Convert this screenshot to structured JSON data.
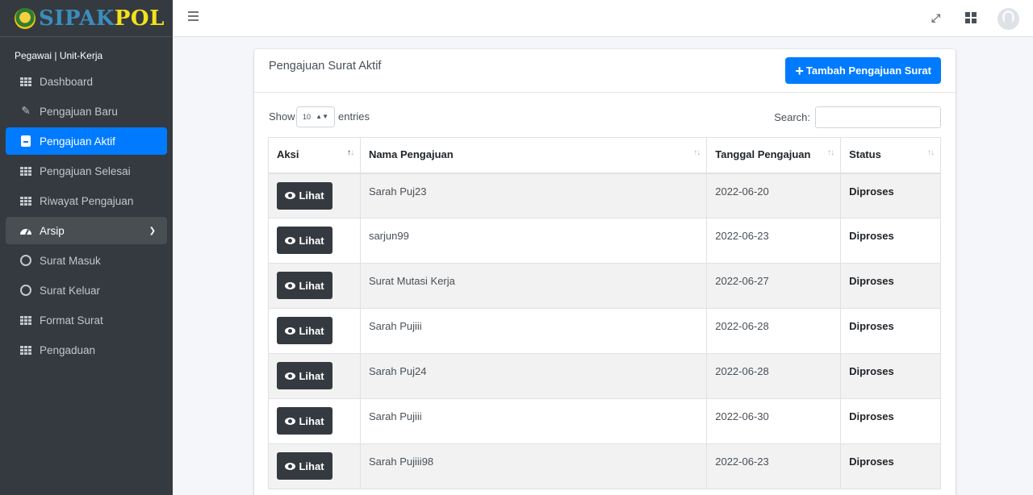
{
  "brand": {
    "part1": "SIPAK",
    "part2": "POL"
  },
  "user_label": "Pegawai | Unit-Kerja",
  "sidebar": {
    "items": [
      {
        "label": "Dashboard",
        "icon": "grid-icon"
      },
      {
        "label": "Pengajuan Baru",
        "icon": "edit-icon"
      },
      {
        "label": "Pengajuan Aktif",
        "icon": "document-icon",
        "active": true
      },
      {
        "label": "Pengajuan Selesai",
        "icon": "grid-icon"
      },
      {
        "label": "Riwayat Pengajuan",
        "icon": "grid-icon"
      },
      {
        "label": "Arsip",
        "icon": "dashboard-gauge-icon",
        "expanded": true
      },
      {
        "label": "Surat Masuk",
        "icon": "circle-icon"
      },
      {
        "label": "Surat Keluar",
        "icon": "circle-icon"
      },
      {
        "label": "Format Surat",
        "icon": "grid-icon"
      },
      {
        "label": "Pengaduan",
        "icon": "grid-icon"
      }
    ]
  },
  "card": {
    "title": "Pengajuan Surat Aktif",
    "add_button": "Tambah Pengajuan Surat"
  },
  "controls": {
    "show_label": "Show",
    "entries_value": "10",
    "entries_label": "entries",
    "search_label": "Search:"
  },
  "table": {
    "headers": [
      "Aksi",
      "Nama Pengajuan",
      "Tanggal Pengajuan",
      "Status"
    ],
    "action_label": "Lihat",
    "rows": [
      {
        "nama": "Sarah Puj23",
        "tanggal": "2022-06-20",
        "status": "Diproses"
      },
      {
        "nama": "sarjun99",
        "tanggal": "2022-06-23",
        "status": "Diproses"
      },
      {
        "nama": "Surat Mutasi Kerja",
        "tanggal": "2022-06-27",
        "status": "Diproses"
      },
      {
        "nama": "Sarah Pujiii",
        "tanggal": "2022-06-28",
        "status": "Diproses"
      },
      {
        "nama": "Sarah Puj24",
        "tanggal": "2022-06-28",
        "status": "Diproses"
      },
      {
        "nama": "Sarah Pujiii",
        "tanggal": "2022-06-30",
        "status": "Diproses"
      },
      {
        "nama": "Sarah Pujiii98",
        "tanggal": "2022-06-23",
        "status": "Diproses"
      }
    ]
  },
  "colors": {
    "sidebar_bg": "#343a40",
    "primary": "#007bff",
    "brand_blue": "#3c8dbc",
    "brand_yellow": "#f5e11b"
  }
}
